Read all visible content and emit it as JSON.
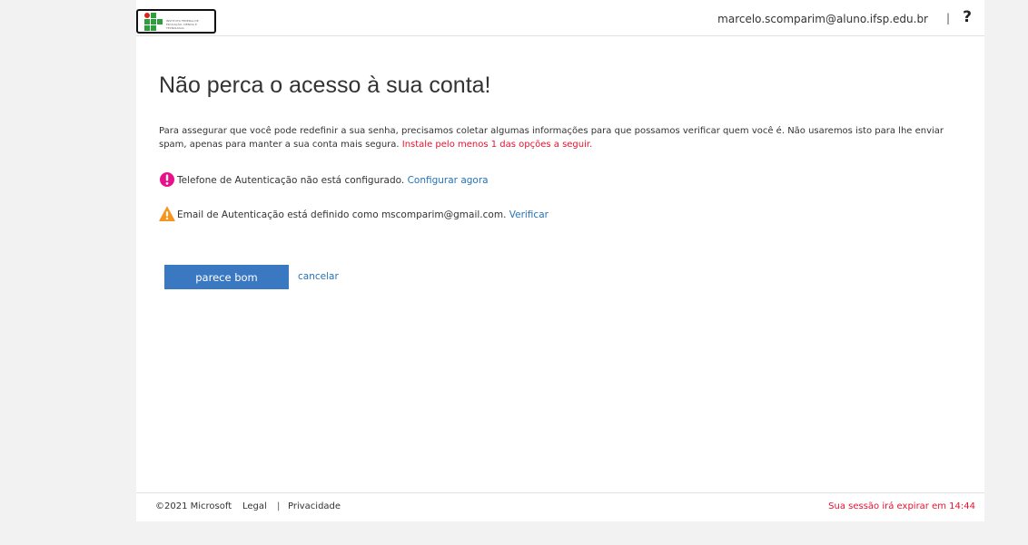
{
  "header": {
    "logo_alt": "INSTITUTO FEDERAL DE EDUCAÇÃO, CIÊNCIA E TECNOLOGIA",
    "user_email": "marcelo.scomparim@aluno.ifsp.edu.br",
    "separator": "|",
    "help_glyph": "?"
  },
  "main": {
    "title": "Não perca o acesso à sua conta!",
    "intro_text": "Para assegurar que você pode redefinir a sua senha, precisamos coletar algumas informações para que possamos verificar quem você é. Não usaremos isto para lhe enviar spam, apenas para manter a sua conta mais segura. ",
    "intro_warning": "Instale pelo menos 1 das opções a seguir.",
    "phone": {
      "icon": "error-icon",
      "text": "Telefone de Autenticação não está configurado. ",
      "link": "Configurar agora"
    },
    "email": {
      "icon": "warning-icon",
      "text": "Email de Autenticação está definido como mscomparim@gmail.com. ",
      "link": "Verificar"
    },
    "primary_button": "parece bom",
    "cancel_link": "cancelar"
  },
  "footer": {
    "copyright": "©2021 Microsoft",
    "legal": "Legal",
    "separator": "|",
    "privacy": "Privacidade",
    "session_notice": "Sua sessão irá expirar em 14:44"
  },
  "colors": {
    "accent": "#3a78c2",
    "link": "#2672b8",
    "warning_text": "#e8112d",
    "error_icon": "#e8118a",
    "warning_icon": "#f7941e"
  }
}
